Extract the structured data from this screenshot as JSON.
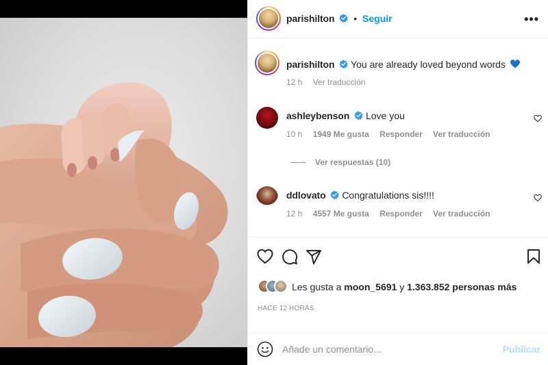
{
  "post": {
    "author": "parishilton",
    "follow_label": "Seguir",
    "more_label": "•••",
    "caption": {
      "username": "parishilton",
      "text": "You are already loved beyond words",
      "time": "12 h",
      "translate": "Ver traducción"
    }
  },
  "comments": [
    {
      "username": "ashleybenson",
      "text": "Love you",
      "time": "10 h",
      "likes": "1949 Me gusta",
      "reply": "Responder",
      "translate": "Ver traducción"
    },
    {
      "username": "ddlovato",
      "text": "Congratulations sis!!!!",
      "time": "12 h",
      "likes": "4557 Me gusta",
      "reply": "Responder",
      "translate": "Ver traducción"
    }
  ],
  "view_replies": "Ver respuestas (10)",
  "likes": {
    "prefix": "Les gusta a",
    "user": "moon_5691",
    "conj": "y",
    "others": "1.363.852 personas más"
  },
  "time_ago": "HACE 12 HORAS",
  "comment_box": {
    "placeholder": "Añade un comentario...",
    "publish_label": "Publicar"
  },
  "colors": {
    "accent": "#0095f6",
    "verified": "#3897f0",
    "heart_emoji": "#1f6fd1",
    "muted": "#8e8e8e",
    "publish_disabled": "#b2dffc"
  },
  "icons": [
    "heart-icon",
    "comment-icon",
    "share-icon",
    "bookmark-icon",
    "emoji-icon",
    "verified-icon",
    "more-icon"
  ]
}
